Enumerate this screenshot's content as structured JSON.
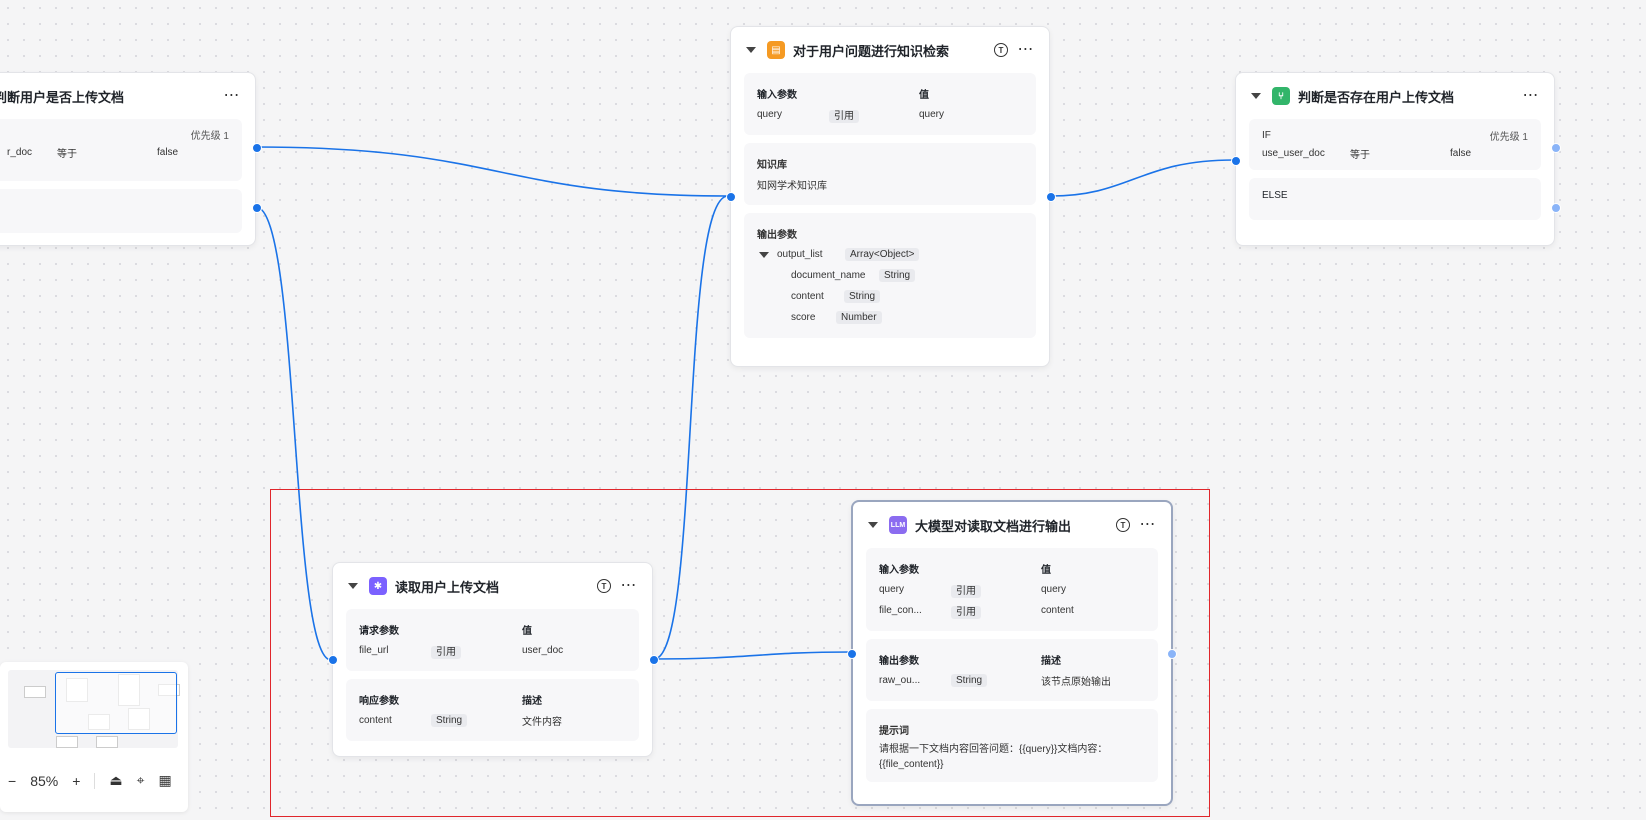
{
  "nodes": {
    "condition_left": {
      "title": "判断用户是否上传文档",
      "priority": "优先级 1",
      "var": "r_doc",
      "op": "等于",
      "value": "false"
    },
    "knowledge": {
      "title": "对于用户问题进行知识检索",
      "input_header": "输入参数",
      "value_header": "值",
      "input_name": "query",
      "input_type": "引用",
      "input_value": "query",
      "kb_title": "知识库",
      "kb_value": "知网学术知识库",
      "output_header": "输出参数",
      "outputs": [
        {
          "name": "output_list",
          "type": "Array<Object>"
        },
        {
          "name": "document_name",
          "type": "String"
        },
        {
          "name": "content",
          "type": "String"
        },
        {
          "name": "score",
          "type": "Number"
        }
      ]
    },
    "condition_right": {
      "title": "判断是否存在用户上传文档",
      "if_label": "IF",
      "priority": "优先级 1",
      "var": "use_user_doc",
      "op": "等于",
      "value": "false",
      "else_label": "ELSE"
    },
    "read_doc": {
      "title": "读取用户上传文档",
      "req_header": "请求参数",
      "value_header": "值",
      "req_name": "file_url",
      "req_type": "引用",
      "req_value": "user_doc",
      "resp_header": "响应参数",
      "desc_header": "描述",
      "resp_name": "content",
      "resp_type": "String",
      "resp_desc": "文件内容"
    },
    "llm": {
      "title": "大模型对读取文档进行输出",
      "icon_text": "LLM",
      "input_header": "输入参数",
      "value_header": "值",
      "inputs": [
        {
          "name": "query",
          "type": "引用",
          "value": "query"
        },
        {
          "name": "file_con...",
          "type": "引用",
          "value": "content"
        }
      ],
      "output_header": "输出参数",
      "desc_header": "描述",
      "out_name": "raw_ou...",
      "out_type": "String",
      "out_desc": "该节点原始输出",
      "prompt_header": "提示词",
      "prompt_text": "请根据一下文档内容回答问题：{{query}}文档内容：{{file_content}}"
    }
  },
  "toolbar": {
    "zoom_out": "−",
    "zoom_level": "85%",
    "zoom_in": "+"
  },
  "colors": {
    "edge": "#1a73e8",
    "selection": "#e0262b",
    "knowledge_icon": "#f59a23",
    "condition_icon": "#32b56a",
    "plugin_icon": "#7b61ff",
    "llm_icon": "#8b6cf0"
  },
  "icons": {
    "knowledge": "knowledge-icon",
    "condition": "condition-icon",
    "plugin": "plugin-icon",
    "llm": "llm-icon"
  }
}
